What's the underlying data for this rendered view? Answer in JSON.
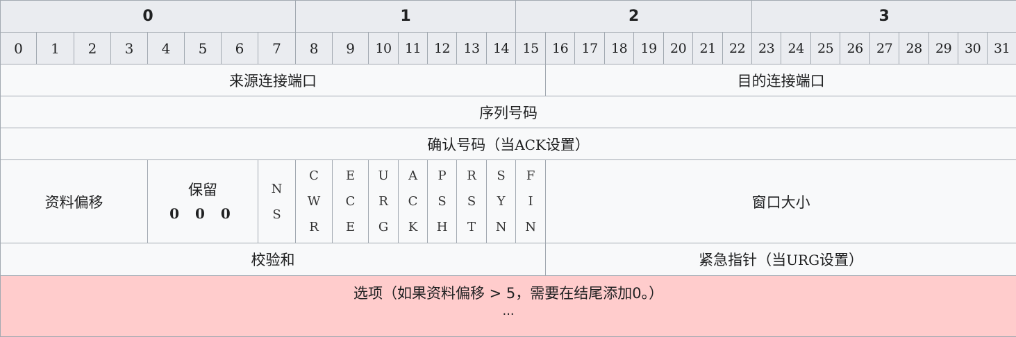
{
  "octets": [
    "0",
    "1",
    "2",
    "3"
  ],
  "bits": [
    "0",
    "1",
    "2",
    "3",
    "4",
    "5",
    "6",
    "7",
    "8",
    "9",
    "10",
    "11",
    "12",
    "13",
    "14",
    "15",
    "16",
    "17",
    "18",
    "19",
    "20",
    "21",
    "22",
    "23",
    "24",
    "25",
    "26",
    "27",
    "28",
    "29",
    "30",
    "31"
  ],
  "fields": {
    "source_port": "来源连接端口",
    "dest_port": "目的连接端口",
    "sequence_number": "序列号码",
    "ack_number_prefix": "确认号码（当",
    "ack_number_code": "ACK",
    "ack_number_suffix": "设置）",
    "data_offset": "资料偏移",
    "reserved_label": "保留",
    "reserved_bits": "0 0 0",
    "window_size": "窗口大小",
    "checksum": "校验和",
    "urgent_prefix": "紧急指针（当",
    "urgent_code": "URG",
    "urgent_suffix": "设置）",
    "options_text": "选项（如果资料偏移 > 5，需要在结尾添加0。）",
    "options_ellipsis": "..."
  },
  "flags": [
    {
      "name": "NS",
      "chars": [
        "N",
        "S"
      ]
    },
    {
      "name": "CWR",
      "chars": [
        "C",
        "W",
        "R"
      ]
    },
    {
      "name": "ECE",
      "chars": [
        "E",
        "C",
        "E"
      ]
    },
    {
      "name": "URG",
      "chars": [
        "U",
        "R",
        "G"
      ]
    },
    {
      "name": "ACK",
      "chars": [
        "A",
        "C",
        "K"
      ]
    },
    {
      "name": "PSH",
      "chars": [
        "P",
        "S",
        "H"
      ]
    },
    {
      "name": "RST",
      "chars": [
        "R",
        "S",
        "T"
      ]
    },
    {
      "name": "SYN",
      "chars": [
        "S",
        "Y",
        "N"
      ]
    },
    {
      "name": "FIN",
      "chars": [
        "F",
        "I",
        "N"
      ]
    }
  ],
  "colors": {
    "header_bg": "#eaecf0",
    "cell_bg": "#f8f9fa",
    "options_bg": "#ffcccc",
    "border": "#a2a9b1"
  }
}
